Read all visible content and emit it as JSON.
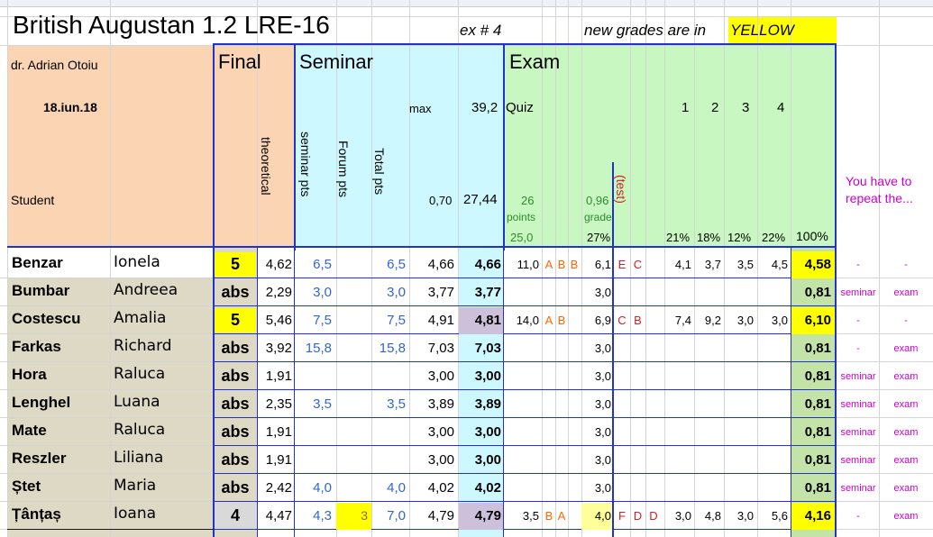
{
  "title": "British Augustan 1.2 LRE-16",
  "ex_label": "ex # 4",
  "note_prefix": "new grades are in",
  "note_highlight": "YELLOW",
  "teacher": "dr. Adrian Otoiu",
  "date": "18.iun.18",
  "student_label": "Student",
  "sections": {
    "final": "Final",
    "seminar": "Seminar",
    "exam": "Exam"
  },
  "headers": {
    "theoretical": "theoretical",
    "seminar_pts": "seminar pts",
    "forum_pts": "Forum pts",
    "total_pts": "Total pts",
    "max": "max",
    "max_val": "39,2",
    "quiz": "Quiz",
    "factor": "0,70",
    "factor_total": "27,44",
    "points_num": "26",
    "points_label": "points",
    "grade_num": "0,96",
    "grade_label": "grade",
    "test": "(test)",
    "q1": "1",
    "q2": "2",
    "q3": "3",
    "q4": "4",
    "pct_25": "25,0",
    "pct_27": "27%",
    "pct_21": "21%",
    "pct_18": "18%",
    "pct_12": "12%",
    "pct_22": "22%",
    "pct_100": "100%",
    "repeat": "You have to repeat the..."
  },
  "rows": [
    {
      "last": "Benzar",
      "first": "Ionela",
      "final": "5",
      "theo": "4,62",
      "sem": "6,5",
      "forum": "",
      "total": "6,5",
      "sem_grade": "4,66",
      "sem_final": "4,66",
      "quiz": "11,0",
      "l1": "A",
      "l2": "B",
      "l3": "B",
      "exam": "6,1",
      "e1": "E",
      "e2": "C",
      "e3": "",
      "q1": "4,1",
      "q2": "3,7",
      "q3": "3,5",
      "q4": "4,5",
      "fin": "4,58",
      "rep1": "-",
      "rep2": "-"
    },
    {
      "last": "Bumbar",
      "first": "Andreea",
      "final": "abs",
      "theo": "2,29",
      "sem": "3,0",
      "forum": "",
      "total": "3,0",
      "sem_grade": "3,77",
      "sem_final": "3,77",
      "quiz": "",
      "l1": "",
      "l2": "",
      "l3": "",
      "exam": "3,0",
      "e1": "",
      "e2": "",
      "e3": "",
      "q1": "",
      "q2": "",
      "q3": "",
      "q4": "",
      "fin": "0,81",
      "rep1": "seminar",
      "rep2": "exam"
    },
    {
      "last": "Costescu",
      "first": "Amalia",
      "final": "5",
      "theo": "5,46",
      "sem": "7,5",
      "forum": "",
      "total": "7,5",
      "sem_grade": "4,91",
      "sem_final": "4,81",
      "quiz": "14,0",
      "l1": "A",
      "l2": "B",
      "l3": "",
      "exam": "6,9",
      "e1": "C",
      "e2": "B",
      "e3": "",
      "q1": "7,4",
      "q2": "9,2",
      "q3": "3,0",
      "q4": "3,0",
      "fin": "6,10",
      "rep1": "-",
      "rep2": "-"
    },
    {
      "last": "Farkas",
      "first": "Richard",
      "final": "abs",
      "theo": "3,92",
      "sem": "15,8",
      "forum": "",
      "total": "15,8",
      "sem_grade": "7,03",
      "sem_final": "7,03",
      "quiz": "",
      "l1": "",
      "l2": "",
      "l3": "",
      "exam": "3,0",
      "e1": "",
      "e2": "",
      "e3": "",
      "q1": "",
      "q2": "",
      "q3": "",
      "q4": "",
      "fin": "0,81",
      "rep1": "-",
      "rep2": "exam"
    },
    {
      "last": "Hora",
      "first": "Raluca",
      "final": "abs",
      "theo": "1,91",
      "sem": "",
      "forum": "",
      "total": "",
      "sem_grade": "3,00",
      "sem_final": "3,00",
      "quiz": "",
      "l1": "",
      "l2": "",
      "l3": "",
      "exam": "3,0",
      "e1": "",
      "e2": "",
      "e3": "",
      "q1": "",
      "q2": "",
      "q3": "",
      "q4": "",
      "fin": "0,81",
      "rep1": "seminar",
      "rep2": "exam"
    },
    {
      "last": "Lenghel",
      "first": "Luana",
      "final": "abs",
      "theo": "2,35",
      "sem": "3,5",
      "forum": "",
      "total": "3,5",
      "sem_grade": "3,89",
      "sem_final": "3,89",
      "quiz": "",
      "l1": "",
      "l2": "",
      "l3": "",
      "exam": "3,0",
      "e1": "",
      "e2": "",
      "e3": "",
      "q1": "",
      "q2": "",
      "q3": "",
      "q4": "",
      "fin": "0,81",
      "rep1": "seminar",
      "rep2": "exam"
    },
    {
      "last": "Mate",
      "first": "Raluca",
      "final": "abs",
      "theo": "1,91",
      "sem": "",
      "forum": "",
      "total": "",
      "sem_grade": "3,00",
      "sem_final": "3,00",
      "quiz": "",
      "l1": "",
      "l2": "",
      "l3": "",
      "exam": "3,0",
      "e1": "",
      "e2": "",
      "e3": "",
      "q1": "",
      "q2": "",
      "q3": "",
      "q4": "",
      "fin": "0,81",
      "rep1": "seminar",
      "rep2": "exam"
    },
    {
      "last": "Reszler",
      "first": "Liliana",
      "final": "abs",
      "theo": "1,91",
      "sem": "",
      "forum": "",
      "total": "",
      "sem_grade": "3,00",
      "sem_final": "3,00",
      "quiz": "",
      "l1": "",
      "l2": "",
      "l3": "",
      "exam": "3,0",
      "e1": "",
      "e2": "",
      "e3": "",
      "q1": "",
      "q2": "",
      "q3": "",
      "q4": "",
      "fin": "0,81",
      "rep1": "seminar",
      "rep2": "exam"
    },
    {
      "last": "Ștet",
      "first": "Maria",
      "final": "abs",
      "theo": "2,42",
      "sem": "4,0",
      "forum": "",
      "total": "4,0",
      "sem_grade": "4,02",
      "sem_final": "4,02",
      "quiz": "",
      "l1": "",
      "l2": "",
      "l3": "",
      "exam": "3,0",
      "e1": "",
      "e2": "",
      "e3": "",
      "q1": "",
      "q2": "",
      "q3": "",
      "q4": "",
      "fin": "0,81",
      "rep1": "seminar",
      "rep2": "exam"
    },
    {
      "last": "Țânțaș",
      "first": "Ioana",
      "final": "4",
      "theo": "4,47",
      "sem": "4,3",
      "forum": "3",
      "total": "7,0",
      "sem_grade": "4,79",
      "sem_final": "4,79",
      "quiz": "3,5",
      "l1": "B",
      "l2": "A",
      "l3": "",
      "exam": "4,0",
      "e1": "F",
      "e2": "D",
      "e3": "D",
      "q1": "3,0",
      "q2": "4,8",
      "q3": "3,0",
      "q4": "5,6",
      "fin": "4,16",
      "rep1": "-",
      "rep2": "exam"
    }
  ],
  "colors": {
    "peach": "#fbd4b4",
    "cyan": "#cdf8ff",
    "green": "#c8f7c1",
    "yellow": "#ffff00",
    "gridblue": "#2233cc"
  }
}
